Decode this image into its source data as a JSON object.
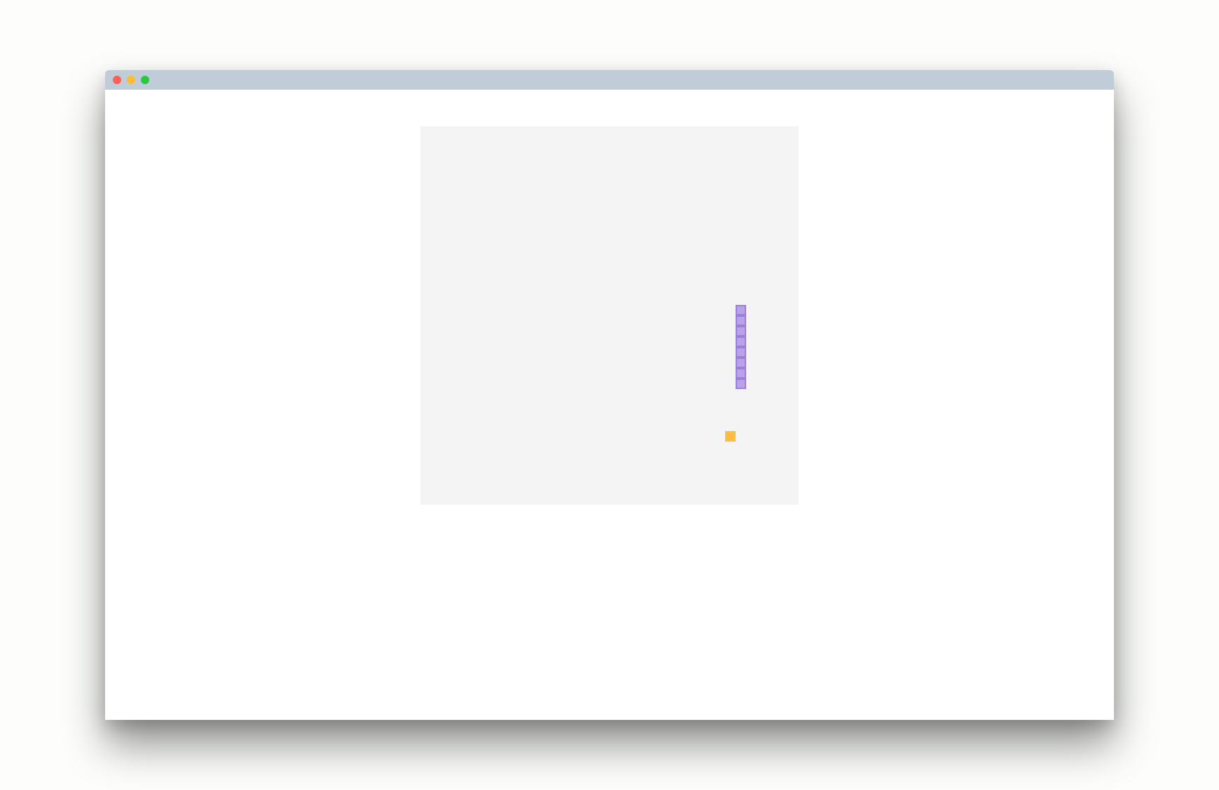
{
  "window": {
    "buttons": [
      {
        "name": "close",
        "color": "#fe5f57"
      },
      {
        "name": "minimize",
        "color": "#febc2e"
      },
      {
        "name": "maximize",
        "color": "#29c840"
      }
    ]
  },
  "game": {
    "grid": {
      "cols": 36,
      "rows": 36
    },
    "colors": {
      "board": "#f4f4f4",
      "snake_fill": "#b8a2ea",
      "snake_border": "#9b80d6",
      "food": "#ffbc42"
    },
    "snake": [
      {
        "col": 30,
        "row": 17
      },
      {
        "col": 30,
        "row": 18
      },
      {
        "col": 30,
        "row": 19
      },
      {
        "col": 30,
        "row": 20
      },
      {
        "col": 30,
        "row": 21
      },
      {
        "col": 30,
        "row": 22
      },
      {
        "col": 30,
        "row": 23
      },
      {
        "col": 30,
        "row": 24
      }
    ],
    "food": {
      "col": 29,
      "row": 29
    }
  }
}
